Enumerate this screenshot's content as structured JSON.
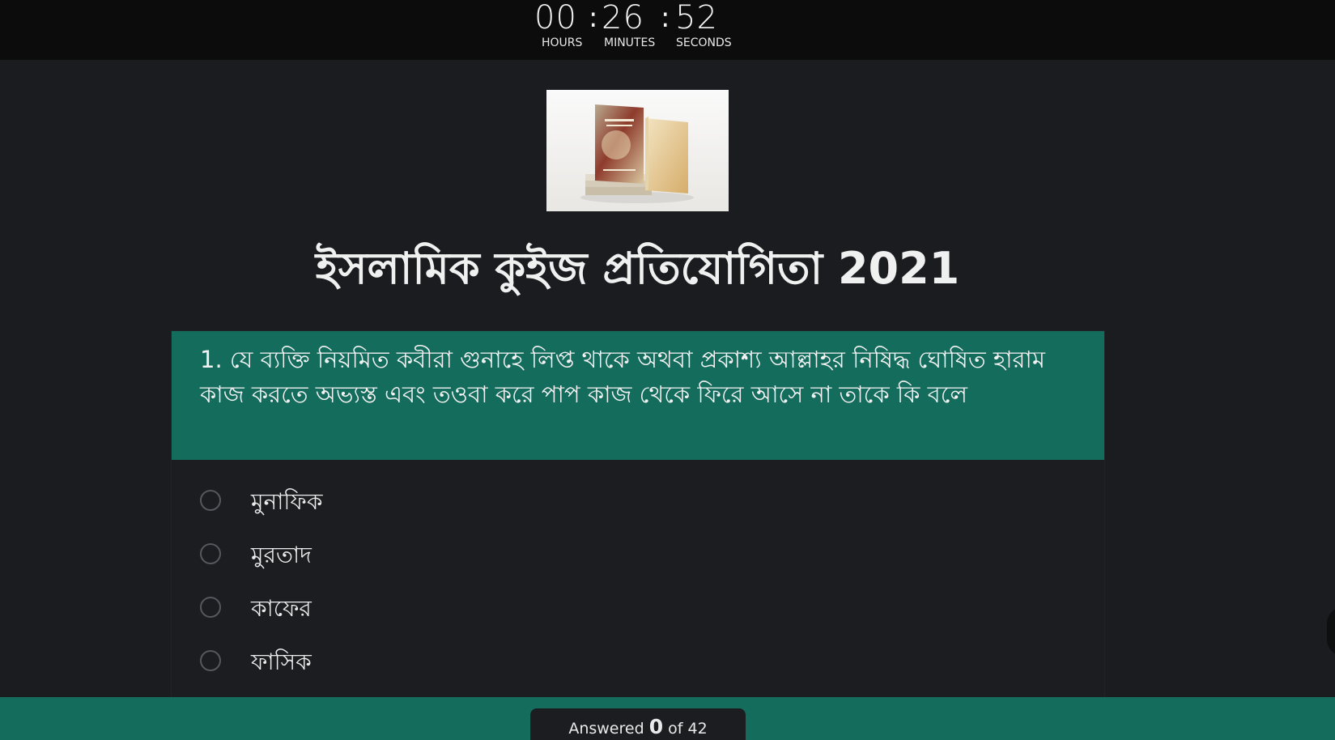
{
  "timer": {
    "hours": "00",
    "minutes": "26",
    "seconds": "52",
    "separator": ":",
    "hours_label": "HOURS",
    "minutes_label": "MINUTES",
    "seconds_label": "SECONDS"
  },
  "quiz": {
    "title": "ইসলামিক কুইজ প্রতিযোগিতা 2021"
  },
  "question": {
    "text": "1. যে ব্যক্তি নিয়মিত কবীরা গুনাহে লিপ্ত থাকে অথবা প্রকাশ্য আল্লাহর নিষিদ্ধ ঘোষিত হারাম কাজ করতে অভ্যস্ত এবং তওবা করে পাপ কাজ থেকে ফিরে আসে না তাকে কি বলে",
    "options": [
      "মুনাফিক",
      "মুরতাদ",
      "কাফের",
      "ফাসিক"
    ]
  },
  "progress": {
    "prefix": "Answered",
    "answered": "0",
    "suffix": "of 42"
  },
  "colors": {
    "accent": "#146c5d",
    "background": "#1a1c1f",
    "timer_bar": "#0c0c0c"
  }
}
